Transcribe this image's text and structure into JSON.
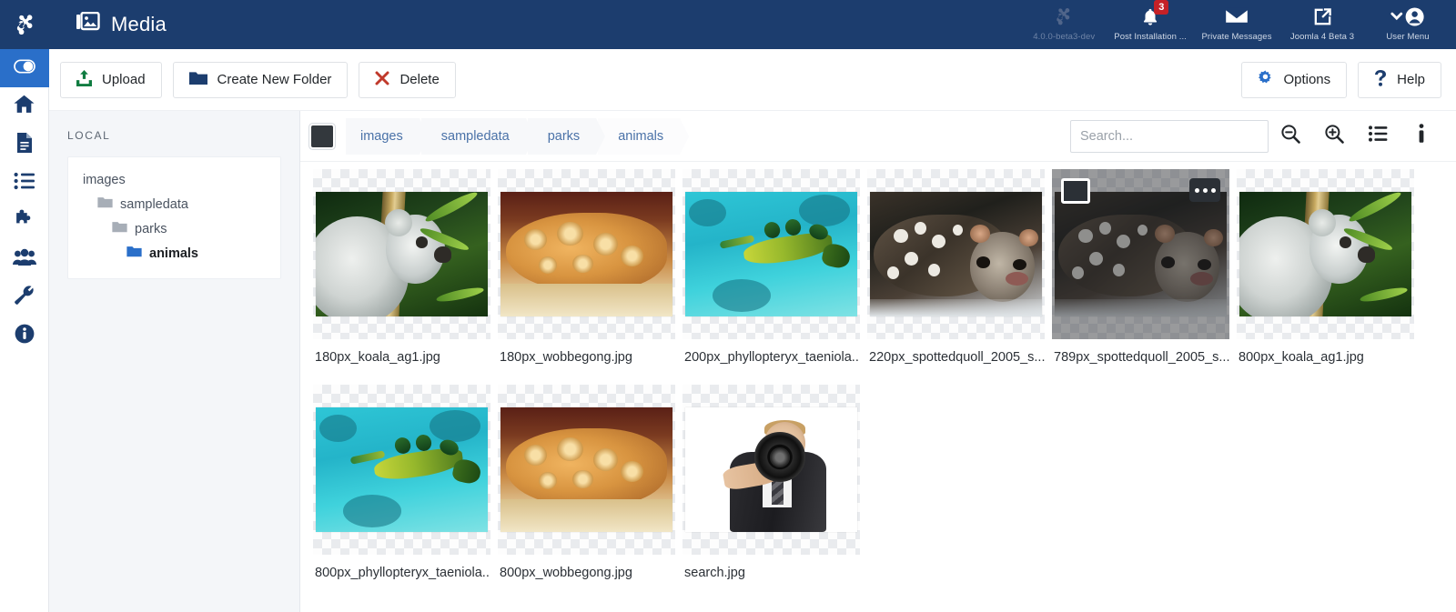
{
  "header": {
    "logo_icon": "joomla-logo-icon",
    "title": "Media",
    "title_icon": "media-image-icon",
    "right_items": [
      {
        "label": "4.0.0-beta3-dev",
        "icon": "joomla-mark-icon",
        "badge": ""
      },
      {
        "label": "Post Installation ...",
        "icon": "bell-icon",
        "badge": "3"
      },
      {
        "label": "Private Messages",
        "icon": "envelope-icon",
        "badge": ""
      },
      {
        "label": "Joomla 4 Beta 3",
        "icon": "external-link-icon",
        "badge": ""
      },
      {
        "label": "User Menu",
        "icon": "user-avatar-icon",
        "badge": ""
      }
    ]
  },
  "rail": {
    "items": [
      {
        "name": "toggle-menu",
        "icon": "toggle-icon",
        "active": true
      },
      {
        "name": "home",
        "icon": "home-icon",
        "active": false
      },
      {
        "name": "content",
        "icon": "document-icon",
        "active": false
      },
      {
        "name": "menus",
        "icon": "list-icon",
        "active": false
      },
      {
        "name": "components",
        "icon": "puzzle-icon",
        "active": false
      },
      {
        "name": "users",
        "icon": "users-icon",
        "active": false
      },
      {
        "name": "system",
        "icon": "wrench-icon",
        "active": false
      },
      {
        "name": "help",
        "icon": "info-circle-icon",
        "active": false
      }
    ]
  },
  "toolbar": {
    "upload_label": "Upload",
    "create_folder_label": "Create New Folder",
    "delete_label": "Delete",
    "options_label": "Options",
    "help_label": "Help"
  },
  "tree": {
    "heading": "LOCAL",
    "nodes": [
      {
        "label": "images",
        "level": 1,
        "active": false,
        "has_icon": false
      },
      {
        "label": "sampledata",
        "level": 2,
        "active": false,
        "has_icon": true
      },
      {
        "label": "parks",
        "level": 3,
        "active": false,
        "has_icon": true
      },
      {
        "label": "animals",
        "level": 4,
        "active": true,
        "has_icon": true
      }
    ]
  },
  "breadcrumb": {
    "items": [
      "images",
      "sampledata",
      "parks",
      "animals"
    ]
  },
  "search": {
    "placeholder": "Search...",
    "value": ""
  },
  "view_tools": [
    {
      "name": "zoom-out",
      "icon": "zoom-out-icon"
    },
    {
      "name": "zoom-in",
      "icon": "zoom-in-icon"
    },
    {
      "name": "toggle-list-view",
      "icon": "list-view-icon"
    },
    {
      "name": "toggle-info",
      "icon": "info-icon"
    }
  ],
  "colors": {
    "header_bg": "#1c3d6e",
    "accent_blue": "#2a6fc9",
    "link_blue": "#4a72a8",
    "badge_red": "#c52127",
    "upload_green": "#107c41",
    "delete_red": "#c0392b"
  },
  "grid": {
    "items": [
      {
        "name": "180px_koala_ag1.jpg",
        "art": "koala",
        "selected": false
      },
      {
        "name": "180px_wobbegong.jpg",
        "art": "wobbe",
        "selected": false
      },
      {
        "name": "200px_phyllopteryx_taeniola...",
        "art": "drag",
        "selected": false
      },
      {
        "name": "220px_spottedquoll_2005_s...",
        "art": "quoll",
        "selected": false
      },
      {
        "name": "789px_spottedquoll_2005_s...",
        "art": "quoll",
        "selected": true
      },
      {
        "name": "800px_koala_ag1.jpg",
        "art": "koala",
        "selected": false
      },
      {
        "name": "800px_phyllopteryx_taeniola...",
        "art": "drag",
        "selected": false
      },
      {
        "name": "800px_wobbegong.jpg",
        "art": "wobbe",
        "selected": false
      },
      {
        "name": "search.jpg",
        "art": "search",
        "selected": false
      }
    ]
  }
}
